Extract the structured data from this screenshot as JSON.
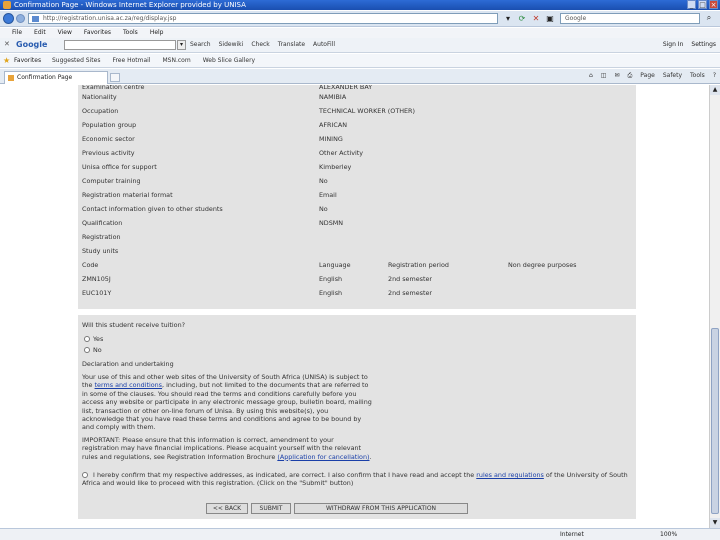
{
  "window": {
    "title": "Confirmation Page - Windows Internet Explorer provided by UNISA"
  },
  "address": {
    "url": "http://registration.unisa.ac.za/reg/display.jsp",
    "search_placeholder": "Google"
  },
  "menu": [
    "File",
    "Edit",
    "View",
    "Favorites",
    "Tools",
    "Help"
  ],
  "google_toolbar": {
    "logo": "Google",
    "items": [
      "Search",
      "Sidewiki",
      "Check",
      "Translate",
      "AutoFill"
    ],
    "right": [
      "Sign In",
      "Settings"
    ]
  },
  "favorites": {
    "label": "Favorites",
    "items": [
      "Suggested Sites",
      "Free Hotmail",
      "MSN.com",
      "Web Slice Gallery"
    ]
  },
  "tab": {
    "label": "Confirmation Page"
  },
  "command_bar": [
    "Page",
    "Safety",
    "Tools"
  ],
  "form": {
    "rows": [
      {
        "k": "Examination centre",
        "v": "ALEXANDER BAY"
      },
      {
        "k": "Nationality",
        "v": "NAMIBIA"
      },
      {
        "k": "Occupation",
        "v": "TECHNICAL WORKER (OTHER)"
      },
      {
        "k": "Population group",
        "v": "AFRICAN"
      },
      {
        "k": "Economic sector",
        "v": "MINING"
      },
      {
        "k": "Previous activity",
        "v": "Other Activity"
      },
      {
        "k": "Unisa office for support",
        "v": "Kimberley"
      },
      {
        "k": "Computer training",
        "v": "No"
      },
      {
        "k": "Registration material format",
        "v": "Email"
      },
      {
        "k": "Contact information given to other students",
        "v": "No"
      },
      {
        "k": "Qualification",
        "v": "NDSMN"
      },
      {
        "k": "Registration",
        "v": ""
      },
      {
        "k": "Study units",
        "v": ""
      }
    ],
    "units_header": {
      "code": "Code",
      "language": "Language",
      "period": "Registration period",
      "npp": "Non degree purposes"
    },
    "units": [
      {
        "code": "ZMN105J",
        "language": "English",
        "period": "2nd semester",
        "npp": ""
      },
      {
        "code": "EUC101Y",
        "language": "English",
        "period": "2nd semester",
        "npp": ""
      }
    ]
  },
  "tuition": {
    "question": "Will this student receive tuition?",
    "yes": "Yes",
    "no": "No"
  },
  "declaration": {
    "heading": "Declaration and undertaking",
    "p1_pre": "Your use of this and other web sites of the University of South Africa (UNISA) is subject to the",
    "p1_link": "terms and conditions",
    "p1_post": ", including, but not limited to the documents that are referred to in some of the clauses. You should read the terms and conditions carefully before you access any website or participate in any electronic message group, bulletin board, mailing list, transaction or other on-line forum of Unisa. By using this website(s), you acknowledge that you have read these terms and conditions and agree to be bound by and comply with them.",
    "p2_pre": "IMPORTANT: Please ensure that this information is correct, amendment to your registration may have financial implications. Please acquaint yourself with the relevant rules and regulations, see Registration Information Brochure",
    "p2_link": "(Application for cancellation)",
    "p2_post": ".",
    "confirm_pre": "I hereby confirm that my respective addresses, as indicated, are correct. I also confirm that I have read and accept the",
    "confirm_link": "rules and regulations",
    "confirm_post": "of the University of South Africa and would like to proceed with this registration. (Click on the \"Submit\" button)"
  },
  "buttons": {
    "back": "<< BACK",
    "submit": "SUBMIT",
    "withdraw": "WITHDRAW FROM THIS APPLICATION"
  },
  "status": {
    "left": "",
    "zone": "Internet",
    "zoom": "100%"
  }
}
